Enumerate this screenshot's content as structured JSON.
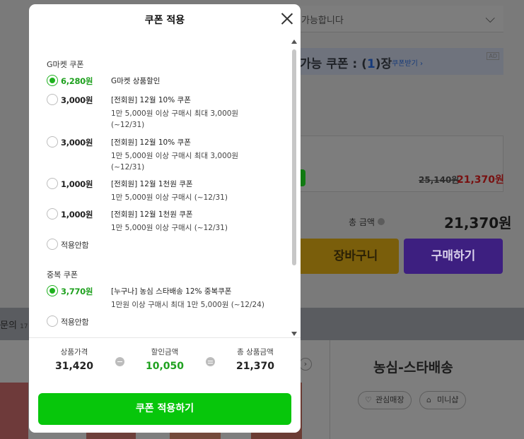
{
  "background": {
    "select_text": "가능합니다",
    "coupon_bar": {
      "prefix": "가능 쿠폰 : (",
      "count": "1",
      "suffix": ")장",
      "link": "쿠폰받기 ›",
      "ad": "AD"
    },
    "price_old": "25,140원",
    "price_new": "21,370원",
    "total_label": "총 금액",
    "total_value": "21,370원",
    "cart_button": "장바구니",
    "buy_button": "구매하기",
    "tab_label": "문의",
    "tab_count": "17",
    "store_name": "농심-스타배송",
    "store_buttons": [
      "관심매장",
      "미니샵"
    ]
  },
  "modal": {
    "title": "쿠폰 적용",
    "sections": [
      {
        "title": "G마켓 쿠폰",
        "items": [
          {
            "amount": "6,280원",
            "name": "G마켓 상품할인",
            "desc1": "",
            "desc2": "",
            "selected": true
          },
          {
            "amount": "3,000원",
            "name": "[전회원] 12월 10% 쿠폰",
            "desc1": "1만 5,000원 이상 구매시 최대 3,000원",
            "desc2": "(~12/31)",
            "selected": false
          },
          {
            "amount": "3,000원",
            "name": "[전회원] 12월 10% 쿠폰",
            "desc1": "1만 5,000원 이상 구매시 최대 3,000원",
            "desc2": "(~12/31)",
            "selected": false
          },
          {
            "amount": "1,000원",
            "name": "[전회원] 12월 1천원 쿠폰",
            "desc1": "1만 5,000원 이상 구매시 (~12/31)",
            "desc2": "",
            "selected": false
          },
          {
            "amount": "1,000원",
            "name": "[전회원] 12월 1천원 쿠폰",
            "desc1": "1만 5,000원 이상 구매시 (~12/31)",
            "desc2": "",
            "selected": false
          },
          {
            "amount": "적용안함",
            "name": "",
            "desc1": "",
            "desc2": "",
            "selected": false
          }
        ]
      },
      {
        "title": "중복 쿠폰",
        "items": [
          {
            "amount": "3,770원",
            "name": "[누구나] 농심 스타배송 12% 중복쿠폰",
            "desc1": "1만원 이상 구매시 최대 1만 5,000원 (~12/24)",
            "desc2": "",
            "selected": true
          },
          {
            "amount": "적용안함",
            "name": "",
            "desc1": "",
            "desc2": "",
            "selected": false
          }
        ]
      }
    ],
    "summary": {
      "price_label": "상품가격",
      "price_value": "31,420",
      "discount_label": "할인금액",
      "discount_value": "10,050",
      "total_label": "총 상품금액",
      "total_value": "21,370"
    },
    "apply_button": "쿠폰 적용하기"
  },
  "colors": {
    "accent_green": "#07c60b",
    "amount_green": "#1fa11f"
  }
}
